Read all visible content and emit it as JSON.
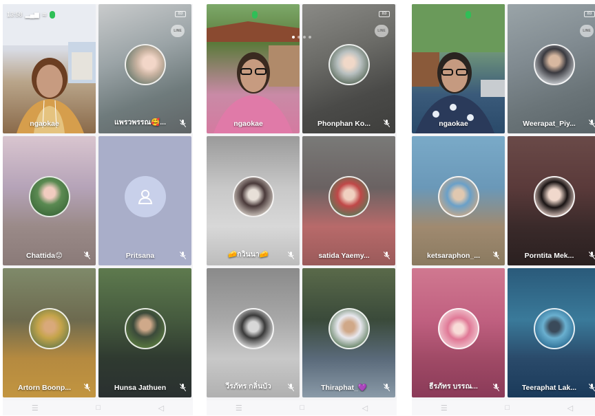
{
  "status_bar": {
    "time": "13:58",
    "app_badge": "",
    "battery": "83"
  },
  "app_logo": "LINE",
  "nav": {
    "menu": "☰",
    "home": "□",
    "back": "◁"
  },
  "screens": [
    {
      "tiles": [
        {
          "name": "ngaokae",
          "self": true
        },
        {
          "name": "แพรวพรรณ🥰..."
        },
        {
          "name": "Chattida😟"
        },
        {
          "name": "Pritsana",
          "placeholder": true
        },
        {
          "name": "Artorn Boonp..."
        },
        {
          "name": "Hunsa Jathuen"
        }
      ]
    },
    {
      "tiles": [
        {
          "name": "ngaokae",
          "self": true
        },
        {
          "name": "Phonphan Ko..."
        },
        {
          "name": "🧀กวินนา🧀"
        },
        {
          "name": "satida Yaemy..."
        },
        {
          "name": "วีรภัทร กลิ่นบัว"
        },
        {
          "name": "Thiraphat_💜"
        }
      ]
    },
    {
      "tiles": [
        {
          "name": "ngaokae",
          "self": true
        },
        {
          "name": "Weerapat_Piy..."
        },
        {
          "name": "ketsaraphon_..."
        },
        {
          "name": "Porntita Mek..."
        },
        {
          "name": "ธีรภัทร บรรณ..."
        },
        {
          "name": "Teeraphat Lak..."
        }
      ]
    }
  ]
}
